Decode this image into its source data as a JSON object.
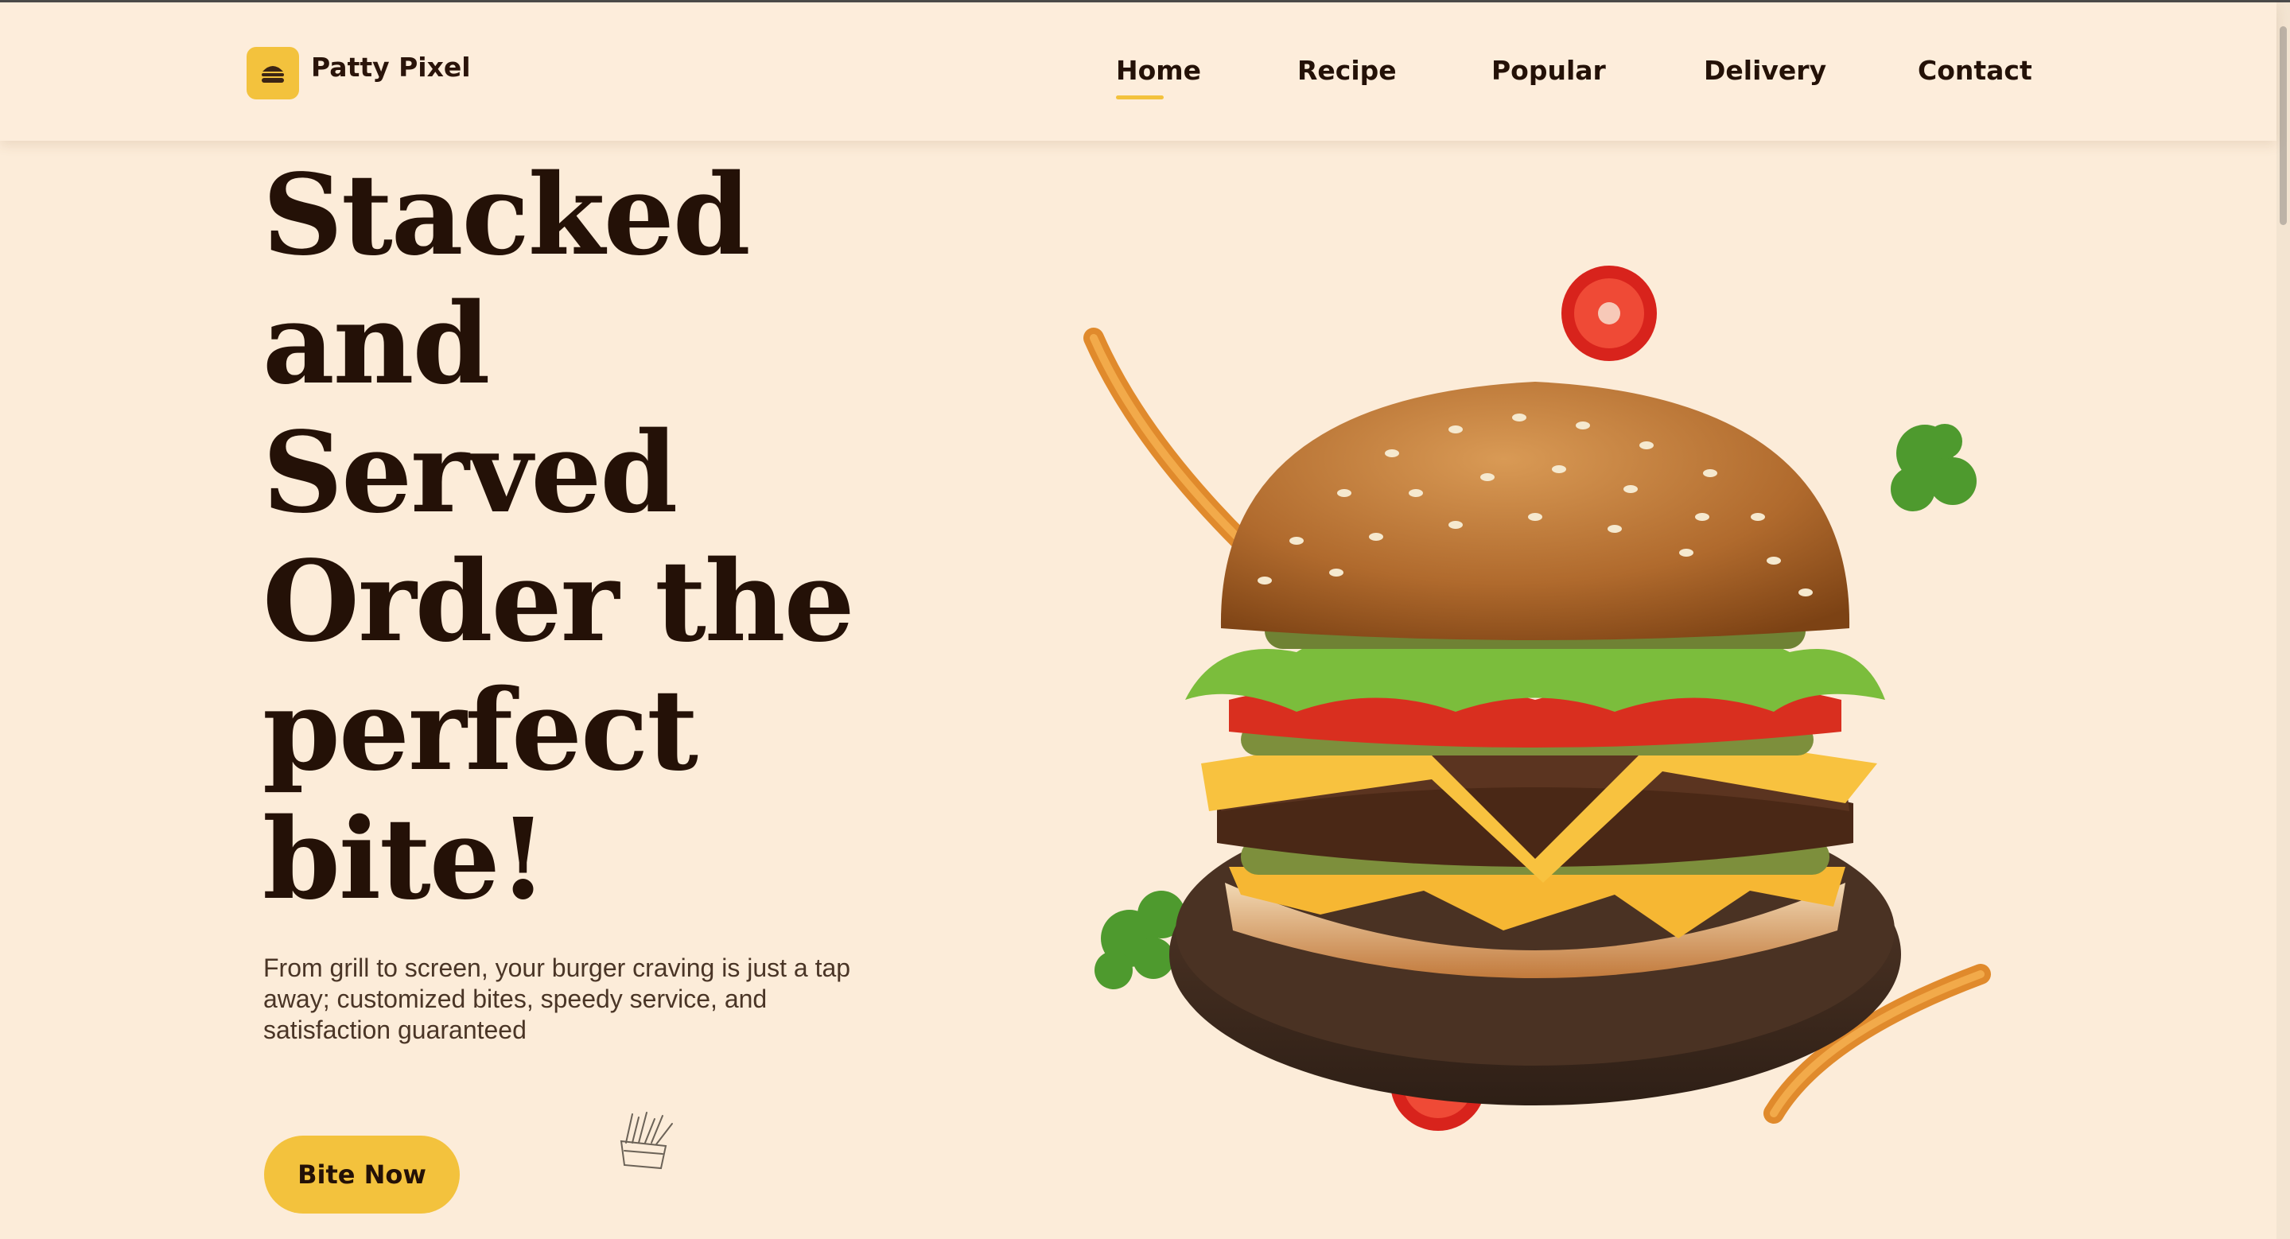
{
  "brand": {
    "name": "Patty Pixel",
    "logo_icon": "burger-icon"
  },
  "nav": {
    "items": [
      {
        "label": "Home",
        "active": true
      },
      {
        "label": "Recipe"
      },
      {
        "label": "Popular"
      },
      {
        "label": "Delivery"
      },
      {
        "label": "Contact"
      }
    ]
  },
  "hero": {
    "headline_lines": [
      "Stacked",
      "and",
      "Served",
      "Order the",
      "perfect",
      "bite!"
    ],
    "subtext": "From grill to screen, your burger craving is just a tap away; customized bites, speedy service, and satisfaction guaranteed",
    "cta_label": "Bite Now",
    "decor_icon": "fries-doodle-icon",
    "image": "burger-illustration"
  },
  "colors": {
    "background": "#fcecd9",
    "accent": "#f3c23d",
    "text": "#241107"
  }
}
